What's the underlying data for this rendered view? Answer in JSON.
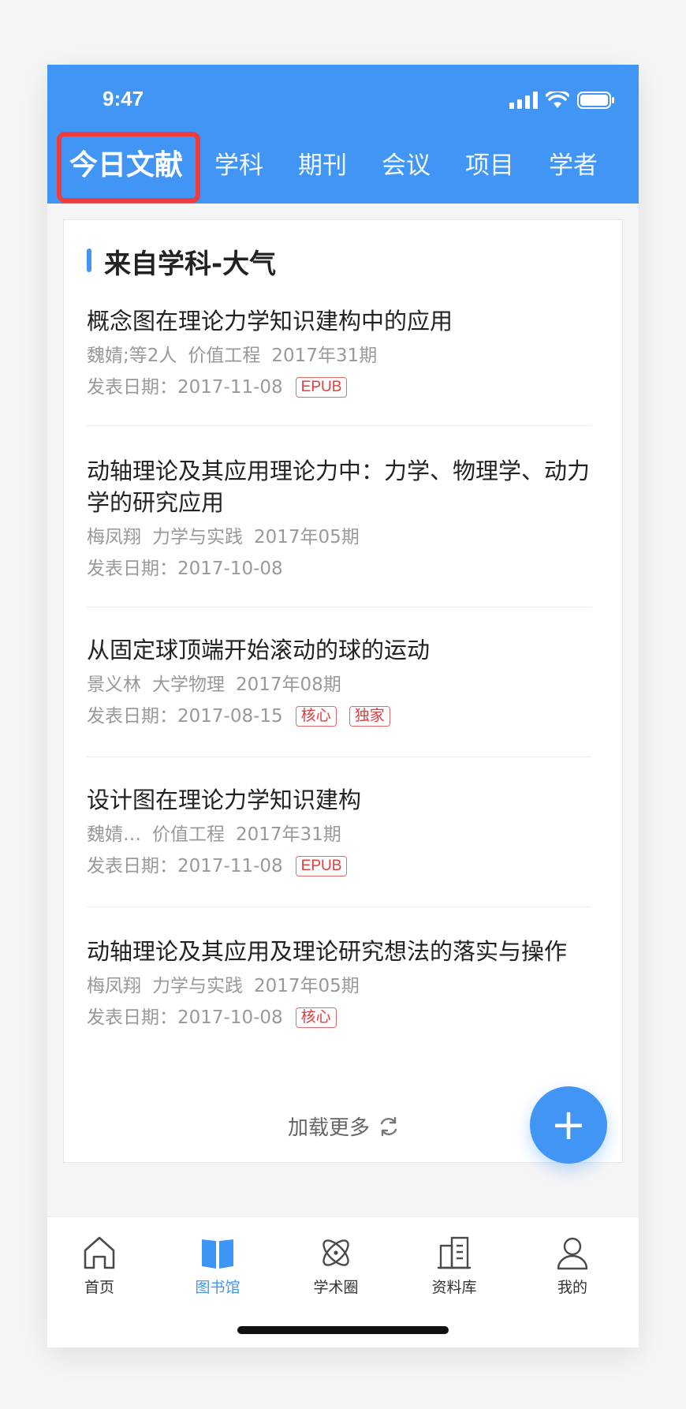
{
  "status": {
    "time": "9:47"
  },
  "tabs": [
    {
      "label": "今日文献",
      "active": true
    },
    {
      "label": "学科"
    },
    {
      "label": "期刊"
    },
    {
      "label": "会议"
    },
    {
      "label": "项目"
    },
    {
      "label": "学者"
    }
  ],
  "section": {
    "title": "来自学科-大气"
  },
  "articles": [
    {
      "title": "概念图在理论力学知识建构中的应用",
      "author": "魏婧;等2人",
      "journal": "价值工程",
      "issue": "2017年31期",
      "date": "发表日期：2017-11-08",
      "tags": [
        "EPUB"
      ]
    },
    {
      "title": "动轴理论及其应用理论力中：力学、物理学、动力学的研究应用",
      "author": "梅凤翔",
      "journal": "力学与实践",
      "issue": "2017年05期",
      "date": "发表日期：2017-10-08",
      "tags": []
    },
    {
      "title": "从固定球顶端开始滚动的球的运动",
      "author": "景义林",
      "journal": "大学物理",
      "issue": "2017年08期",
      "date": "发表日期：2017-08-15",
      "tags": [
        "核心",
        "独家"
      ]
    },
    {
      "title": "设计图在理论力学知识建构",
      "author": "魏婧…",
      "journal": "价值工程",
      "issue": "2017年31期",
      "date": "发表日期：2017-11-08",
      "tags": [
        "EPUB"
      ]
    },
    {
      "title": "动轴理论及其应用及理论研究想法的落实与操作",
      "author": "梅凤翔",
      "journal": "力学与实践",
      "issue": "2017年05期",
      "date": "发表日期：2017-10-08",
      "tags": [
        "核心"
      ]
    }
  ],
  "load_more": {
    "label": "加载更多",
    "icon": "refresh-icon"
  },
  "fab": {
    "label": "+",
    "icon": "plus-icon"
  },
  "tabbar": [
    {
      "label": "首页",
      "icon": "home-icon"
    },
    {
      "label": "图书馆",
      "icon": "book-icon",
      "active": true
    },
    {
      "label": "学术圈",
      "icon": "atom-icon"
    },
    {
      "label": "资料库",
      "icon": "building-icon"
    },
    {
      "label": "我的",
      "icon": "user-icon"
    }
  ],
  "colors": {
    "primary": "#4196f5",
    "highlight": "#ee3b3b",
    "tag": "#e23c3c"
  }
}
